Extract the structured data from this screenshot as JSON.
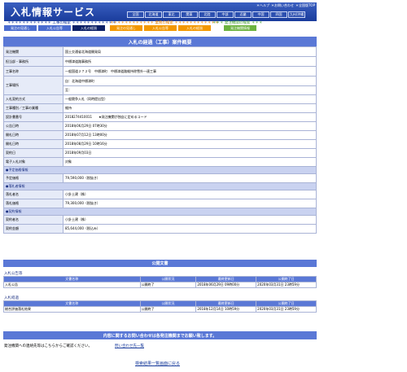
{
  "header": {
    "site_title": "入札情報サービス",
    "top_links": [
      "＊ヘルプ",
      "＊お問い合わせ",
      "＊全国版TOP"
    ],
    "regions": [
      "全国",
      "北海道",
      "東北",
      "関東",
      "北陸",
      "中部",
      "近畿",
      "中国",
      "四国",
      "九州/沖縄"
    ]
  },
  "search_labels": {
    "construction": "＊＊＊＊＊＊＊＊＊＊＊＊ 工事の検索 ＊＊＊＊＊＊＊＊＊＊＊＊",
    "services": "＊＊＊＊＊＊＊＊＊＊＊＊ 業務の検索 ＊＊＊＊＊＊＊＊＊＊＊＊",
    "agency": "＊＊＊ 発注機関の検索 ＊＊＊"
  },
  "tabs": {
    "construction": [
      "発注の見通し",
      "入札公告等",
      "入札の経過"
    ],
    "services": [
      "発注の見通し",
      "入札公告等",
      "入札の経過"
    ],
    "agency": "発注機関情報"
  },
  "main": {
    "title": "入札の経過（工事）案件概要",
    "rows": [
      {
        "type": "kv",
        "key": "発注機関",
        "value": "国土交通省北海道開発局"
      },
      {
        "type": "kv",
        "key": "担当部・事務所",
        "value": "中標津道路事務所"
      },
      {
        "type": "kv",
        "key": "工事名称",
        "value": "一般国道２７２号　中標津町　中標津道路維持除雪外一連工事"
      },
      {
        "type": "kv2",
        "key": "工事場所",
        "value": "自：北海道中標津町",
        "value2": "至："
      },
      {
        "type": "kv",
        "key": "入札契約方式",
        "value": "一般競争入札（同時提出型）"
      },
      {
        "type": "kv",
        "key": "工事種別／工事の業種",
        "value": "維持"
      },
      {
        "type": "kv",
        "key": "設計書番号",
        "value": "2018274410011　　★発注機関が独自に定めるコード"
      },
      {
        "type": "kv",
        "key": "公告日時",
        "value": "2018年06月29日 07時30分"
      },
      {
        "type": "kv",
        "key": "開札日時",
        "value": "2018年07月12日 13時00分"
      },
      {
        "type": "kv",
        "key": "開札日時",
        "value": "2018年08月29日 10時16分"
      },
      {
        "type": "kv",
        "key": "契約日",
        "value": "2018年09月03日"
      },
      {
        "type": "kv",
        "key": "電子入札対象",
        "value": "対象"
      },
      {
        "type": "section",
        "key": "●予定価格情報"
      },
      {
        "type": "kv",
        "key": "予定価格",
        "value": "79,590,000（税抜き）"
      },
      {
        "type": "section",
        "key": "●落札者情報"
      },
      {
        "type": "kv",
        "key": "落札者名",
        "value": "小針土建（株）"
      },
      {
        "type": "kv",
        "key": "落札価格",
        "value": "79,300,000（税抜き）"
      },
      {
        "type": "section",
        "key": "●契約情報"
      },
      {
        "type": "kv",
        "key": "契約者名",
        "value": "小針土建（株）"
      },
      {
        "type": "kv",
        "key": "契約金額",
        "value": "85,644,000（税込み）"
      }
    ]
  },
  "public_docs": {
    "title": "公開文書",
    "groups": [
      {
        "label": "入札公告等",
        "headers": [
          "文書名称",
          "公開状況",
          "最終更新日",
          "公開終了日"
        ],
        "rows": [
          [
            "入札公告",
            "公開終了",
            "2018年06月29日 09時00分",
            "2020年03月31日 23時59分"
          ]
        ]
      },
      {
        "label": "入札経過",
        "headers": [
          "文書名称",
          "公開状況",
          "最終更新日",
          "公開終了日"
        ],
        "rows": [
          [
            "総合評価落札結果",
            "公開終了",
            "2018年12月14日 10時59分",
            "2020年03月31日 23時59分"
          ]
        ]
      }
    ]
  },
  "footer": {
    "contact_bar": "内容に関するお問い合わせは各発注機関までお願い致します。",
    "contact_text": "発注機関への連絡先等はこちらからご確認ください。",
    "contact_link": "問い合わせ先一覧",
    "back_link": "検索結果一覧画面に戻る"
  },
  "colors": {
    "header_blue": "#1a3c9c",
    "bar_blue": "#5a78d6",
    "active_tab": "#0b1f66",
    "orange": "#f39800",
    "green": "#6cb33f"
  }
}
